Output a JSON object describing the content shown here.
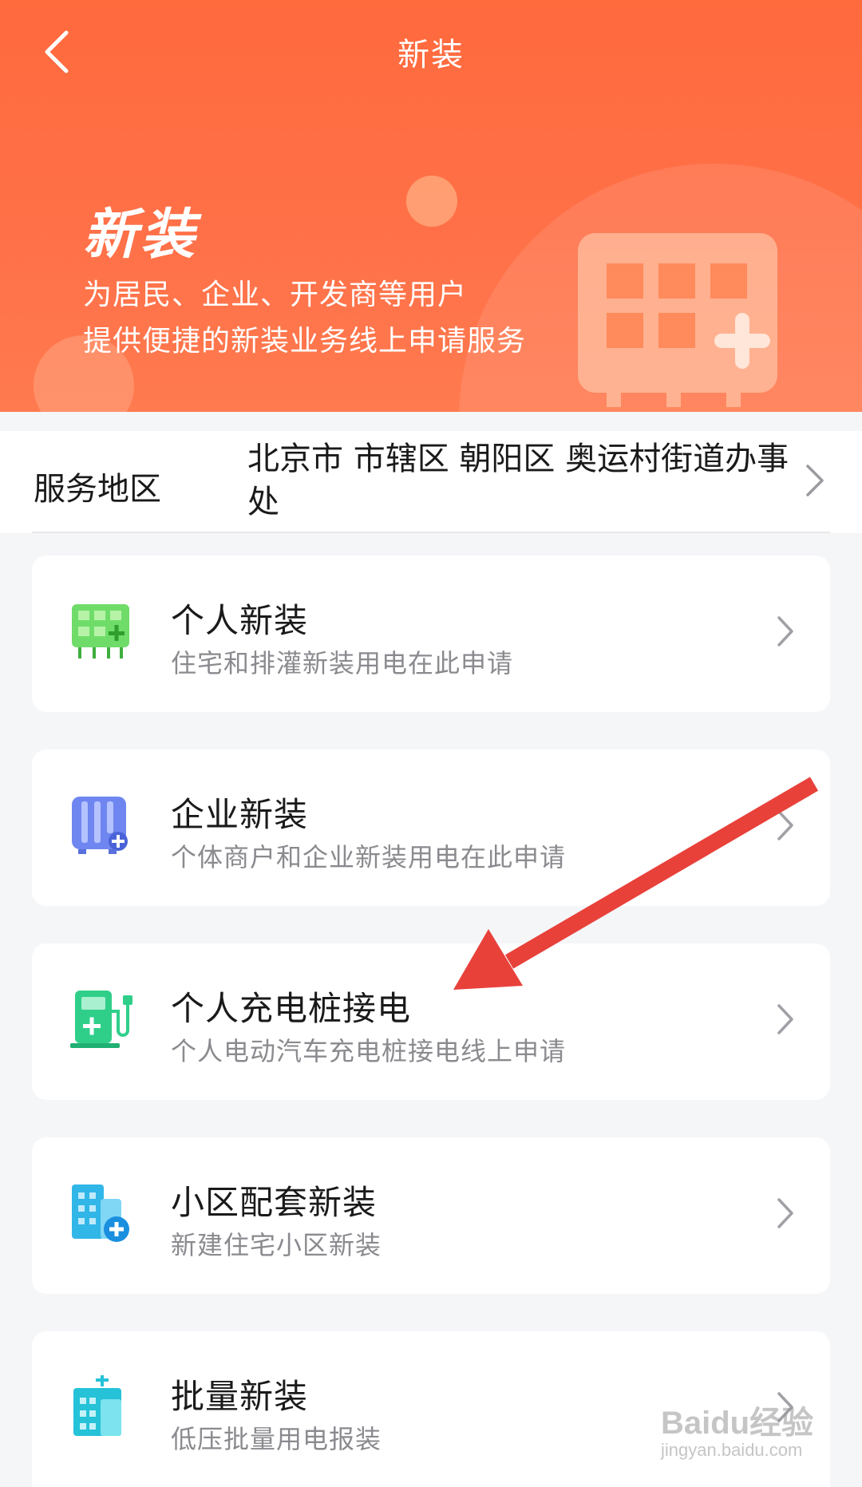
{
  "nav": {
    "title": "新装"
  },
  "hero": {
    "title": "新装",
    "line1": "为居民、企业、开发商等用户",
    "line2": "提供便捷的新装业务线上申请服务"
  },
  "service_area": {
    "label": "服务地区",
    "value": "北京市 市辖区 朝阳区 奥运村街道办事处"
  },
  "cards": [
    {
      "title": "个人新装",
      "desc": "住宅和排灌新装用电在此申请",
      "icon": "meter-green-icon"
    },
    {
      "title": "企业新装",
      "desc": "个体商户和企业新装用电在此申请",
      "icon": "meter-blue-icon"
    },
    {
      "title": "个人充电桩接电",
      "desc": "个人电动汽车充电桩接电线上申请",
      "icon": "charging-pile-icon"
    },
    {
      "title": "小区配套新装",
      "desc": "新建住宅小区新装",
      "icon": "building-plus-icon"
    },
    {
      "title": "批量新装",
      "desc": "低压批量用电报装",
      "icon": "building-batch-icon"
    }
  ],
  "watermark": {
    "main": "Baidu经验",
    "sub": "jingyan.baidu.com"
  },
  "colors": {
    "header": "#ff6a3d",
    "annotation_arrow": "#e8413a",
    "text_primary": "#1a1a1a",
    "text_secondary": "#8a8a8f"
  }
}
